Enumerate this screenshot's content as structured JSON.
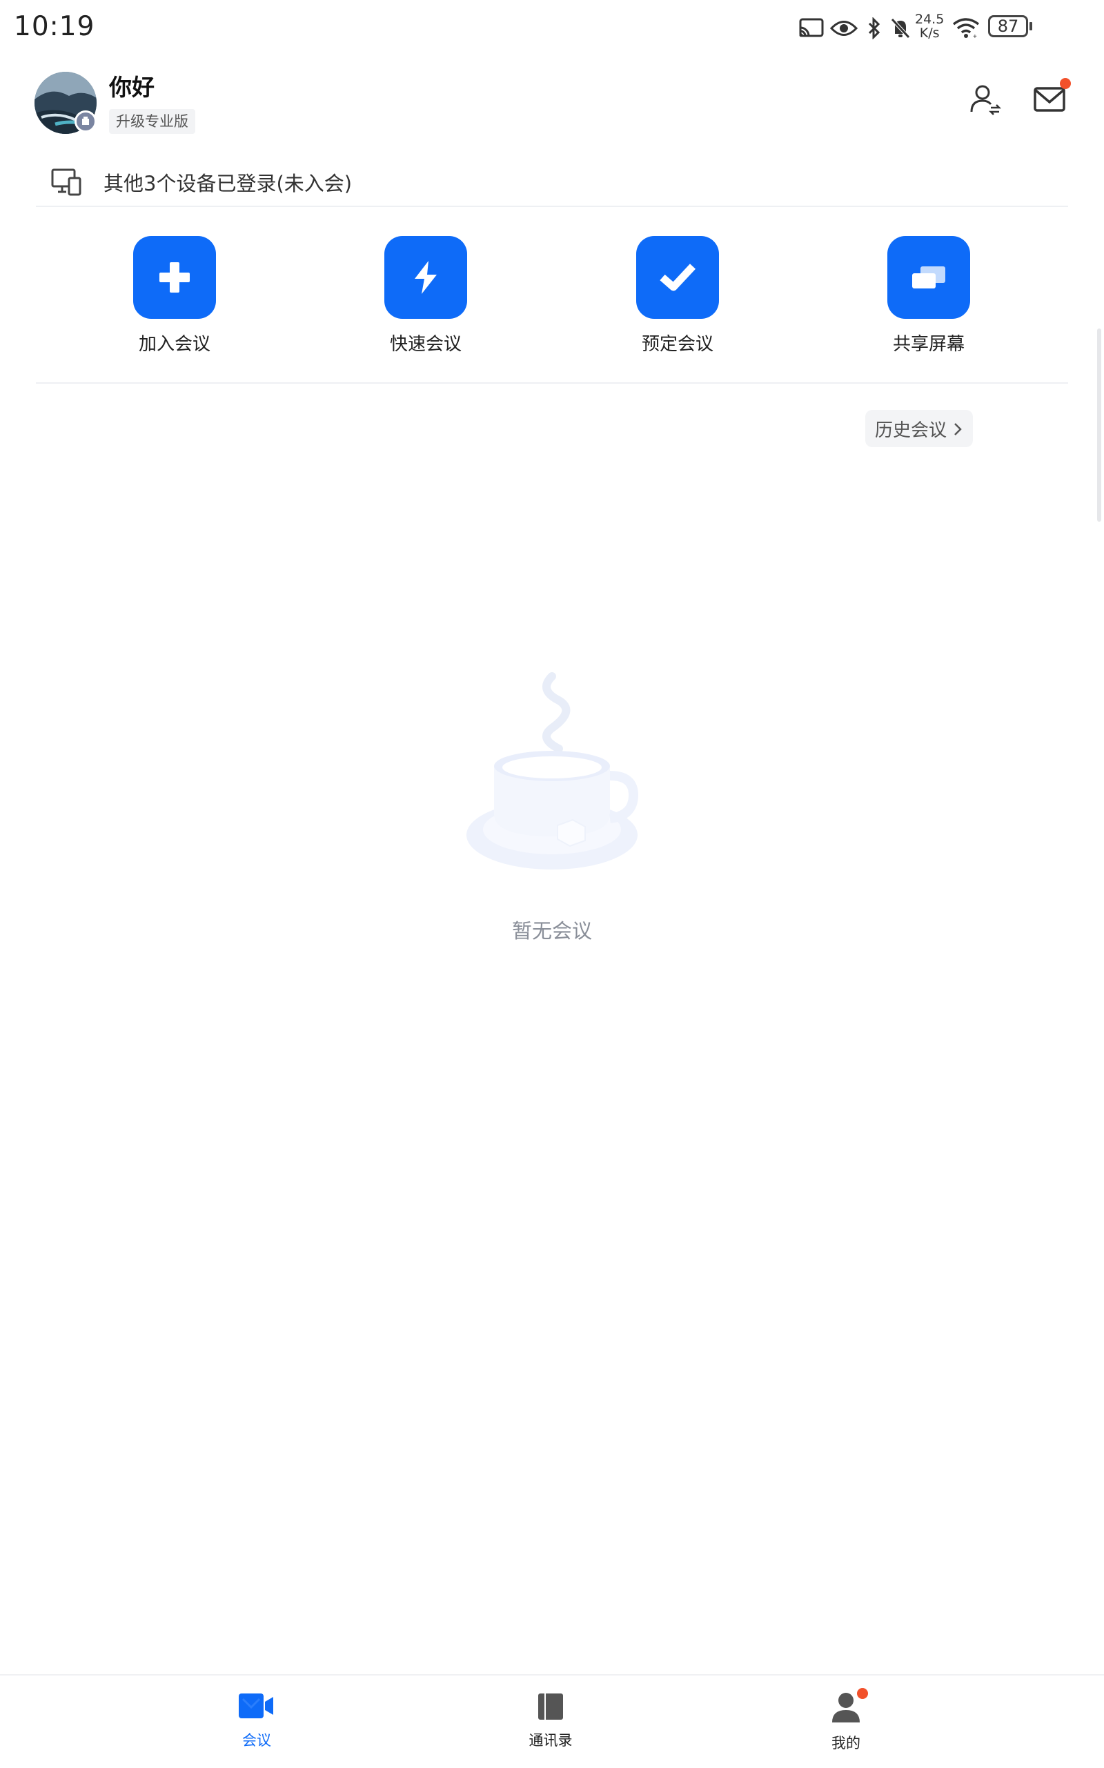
{
  "status_bar": {
    "time": "10:19",
    "net_speed_value": "24.5",
    "net_speed_unit": "K/s",
    "battery": "87",
    "icons": [
      "cast-icon",
      "eye-icon",
      "bluetooth-icon",
      "mute-icon",
      "wifi-icon",
      "battery-icon"
    ]
  },
  "header": {
    "greeting": "你好",
    "upgrade_label": "升级专业版",
    "icons": [
      "contacts-switch-icon",
      "mail-icon"
    ]
  },
  "devices": {
    "text": "其他3个设备已登录(未入会)"
  },
  "actions": [
    {
      "label": "加入会议",
      "icon": "plus-icon"
    },
    {
      "label": "快速会议",
      "icon": "lightning-icon"
    },
    {
      "label": "预定会议",
      "icon": "check-icon"
    },
    {
      "label": "共享屏幕",
      "icon": "share-screen-icon"
    }
  ],
  "history": {
    "label": "历史会议"
  },
  "empty": {
    "text": "暂无会议"
  },
  "bottom_nav": [
    {
      "label": "会议",
      "icon": "video-icon",
      "active": true
    },
    {
      "label": "通讯录",
      "icon": "book-icon",
      "active": false
    },
    {
      "label": "我的",
      "icon": "person-icon",
      "active": false
    }
  ],
  "colors": {
    "accent": "#0e6bf8",
    "notification_dot": "#f2512b",
    "inactive_nav": "#555555"
  }
}
